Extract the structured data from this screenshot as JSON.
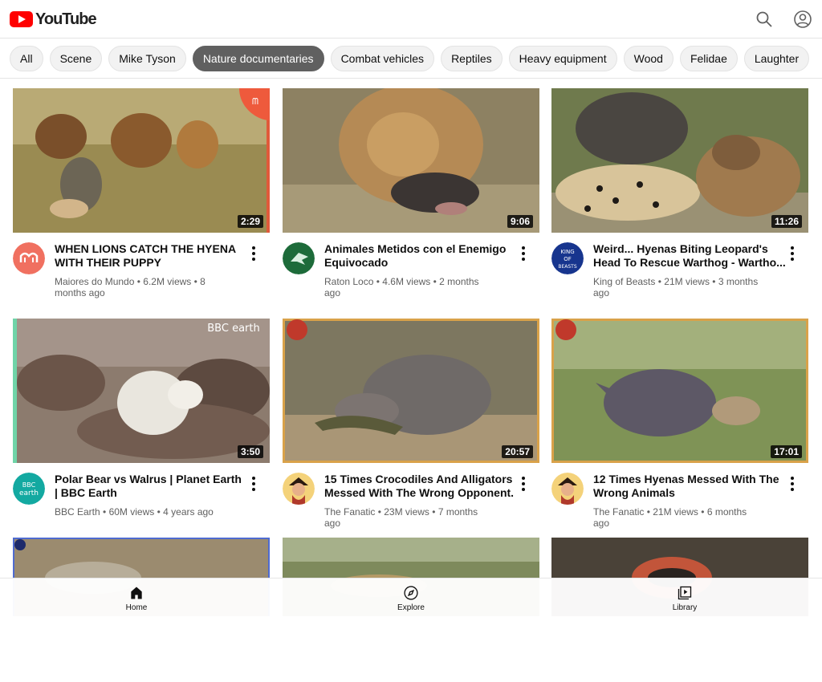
{
  "header": {
    "brand": "YouTube"
  },
  "chips": [
    "All",
    "Scene",
    "Mike Tyson",
    "Nature documentaries",
    "Combat vehicles",
    "Reptiles",
    "Heavy equipment",
    "Wood",
    "Felidae",
    "Laughter"
  ],
  "active_chip": "Nature documentaries",
  "videos": [
    {
      "title": "WHEN LIONS CATCH THE HYENA WITH THEIR PUPPY",
      "channel": "Maiores do Mundo",
      "views": "6.2M views",
      "age": "8 months ago",
      "duration": "2:29"
    },
    {
      "title": "Animales Metidos con el Enemigo Equivocado",
      "channel": "Raton Loco",
      "views": "4.6M views",
      "age": "2 months ago",
      "duration": "9:06"
    },
    {
      "title": "Weird... Hyenas Biting Leopard's Head To Rescue Warthog - Wartho...",
      "channel": "King of Beasts",
      "views": "21M views",
      "age": "3 months ago",
      "duration": "11:26"
    },
    {
      "title": "Polar Bear vs Walrus | Planet Earth | BBC Earth",
      "channel": "BBC Earth",
      "views": "60M views",
      "age": "4 years ago",
      "duration": "3:50"
    },
    {
      "title": "15 Times Crocodiles And Alligators Messed With The Wrong Opponent.",
      "channel": "The Fanatic",
      "views": "23M views",
      "age": "7 months ago",
      "duration": "20:57"
    },
    {
      "title": "12 Times Hyenas Messed With The Wrong Animals",
      "channel": "The Fanatic",
      "views": "21M views",
      "age": "6 months ago",
      "duration": "17:01"
    }
  ],
  "avatars": {
    "king": [
      "KING",
      "OF",
      "BEASTS"
    ],
    "bbc": [
      "BBC",
      "earth"
    ]
  },
  "watermarks": {
    "bbc": "BBC earth"
  },
  "nav": {
    "home": "Home",
    "explore": "Explore",
    "library": "Library"
  },
  "colors": {
    "brand": "#ff0000",
    "active_chip": "#606060",
    "meta_text": "#606060"
  }
}
